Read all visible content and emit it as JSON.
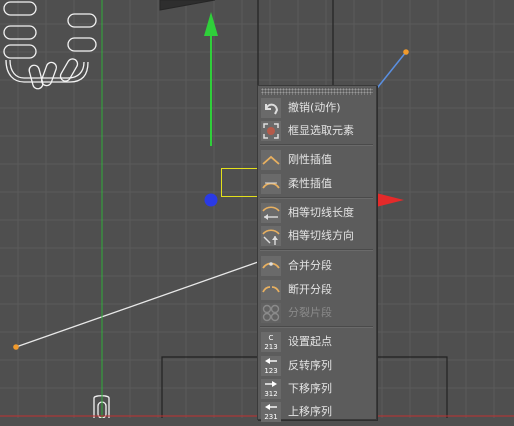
{
  "context_menu": {
    "items": [
      {
        "label": "撤销(动作)",
        "icon": "undo-icon",
        "enabled": true
      },
      {
        "label": "框显选取元素",
        "icon": "frame-selection-icon",
        "enabled": true
      },
      {
        "label": "刚性插值",
        "icon": "hard-interpolation-icon",
        "enabled": true
      },
      {
        "label": "柔性插值",
        "icon": "soft-interpolation-icon",
        "enabled": true,
        "highlighted": true
      },
      {
        "label": "相等切线长度",
        "icon": "equal-tangent-length-icon",
        "enabled": true
      },
      {
        "label": "相等切线方向",
        "icon": "equal-tangent-direction-icon",
        "enabled": true
      },
      {
        "label": "合并分段",
        "icon": "join-segment-icon",
        "enabled": true
      },
      {
        "label": "断开分段",
        "icon": "break-segment-icon",
        "enabled": true
      },
      {
        "label": "分裂片段",
        "icon": "explode-segments-icon",
        "enabled": false
      },
      {
        "label": "设置起点",
        "icon": "set-first-point-icon",
        "enabled": true
      },
      {
        "label": "反转序列",
        "icon": "reverse-sequence-icon",
        "enabled": true
      },
      {
        "label": "下移序列",
        "icon": "move-down-sequence-icon",
        "enabled": true
      },
      {
        "label": "上移序列",
        "icon": "move-up-sequence-icon",
        "enabled": true
      }
    ],
    "icon_text": {
      "set_first_top": "C",
      "set_first_bottom": "213",
      "reverse_bottom": "123",
      "move_down_bottom": "312",
      "move_up_bottom": "231"
    }
  },
  "colors": {
    "viewport_bg": "#4f4f4f",
    "grid": "#5b5b5b",
    "y_axis": "#2fcf3a",
    "x_axis": "#e52a2a",
    "z_handle": "#2a3ae5",
    "spline": "#e8e8e8",
    "point": "#f09a2c",
    "highlight": "#e3e01b",
    "menu_bg": "#5c5c5c",
    "menu_text": "#e4e4e4"
  }
}
